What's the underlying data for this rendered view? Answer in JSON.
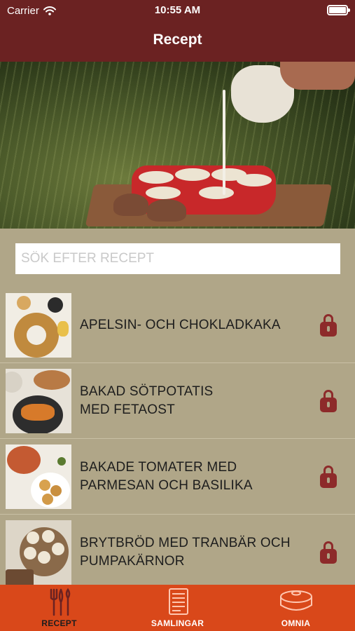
{
  "status_bar": {
    "carrier": "Carrier",
    "time": "10:55 AM"
  },
  "header": {
    "title": "Recept"
  },
  "search": {
    "placeholder": "SÖK EFTER RECEPT"
  },
  "recipes": [
    {
      "title_line1": "APELSIN- OCH CHOKLADKAKA",
      "title_line2": ""
    },
    {
      "title_line1": "BAKAD SÖTPOTATIS",
      "title_line2": "MED FETAOST"
    },
    {
      "title_line1": "BAKADE TOMATER MED",
      "title_line2": "PARMESAN OCH BASILIKA"
    },
    {
      "title_line1": "BRYTBRÖD MED TRANBÄR OCH",
      "title_line2": "PUMPAKÄRNOR"
    }
  ],
  "tabs": [
    {
      "label": "RECEPT",
      "icon": "cutlery-icon",
      "active": true
    },
    {
      "label": "SAMLINGAR",
      "icon": "book-icon",
      "active": false
    },
    {
      "label": "OMNIA",
      "icon": "pot-icon",
      "active": false
    }
  ],
  "colors": {
    "header": "#6b2222",
    "background": "#b0a688",
    "tabbar": "#d9481a",
    "lock": "#8d2a2a"
  }
}
